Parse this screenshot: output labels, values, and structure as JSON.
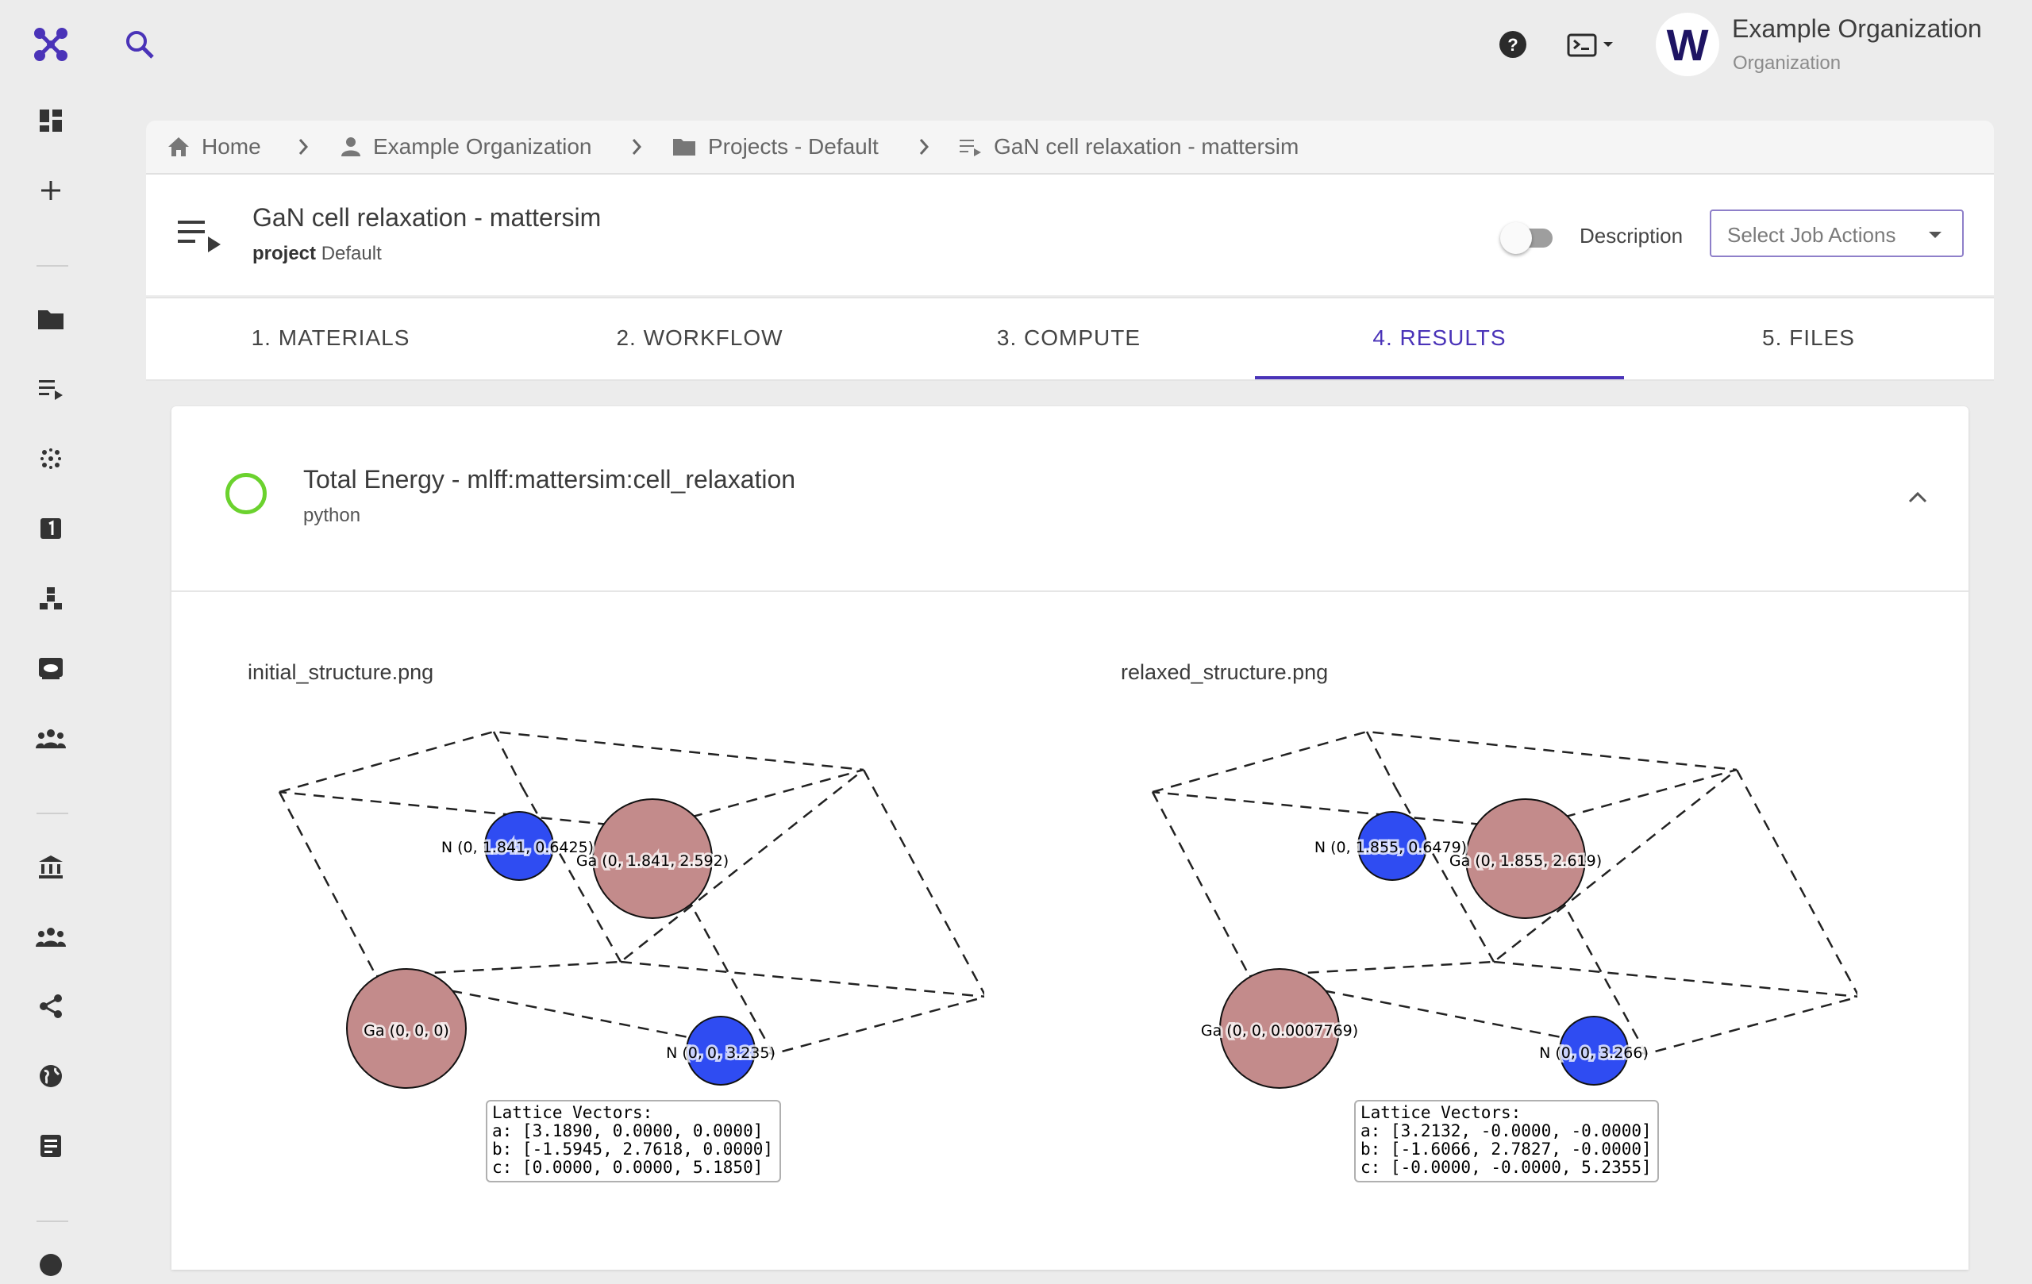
{
  "nav": {
    "items": [
      "Dashboard",
      "Create",
      "Projects",
      "Jobs",
      "Materials",
      "Properties",
      "Workflows",
      "Cloud Jobs",
      "Team",
      "Bank",
      "Accounts",
      "Share",
      "Explore",
      "Logs"
    ]
  },
  "topbar": {
    "org_name": "Example Organization",
    "org_type": "Organization",
    "avatar_letter": "W"
  },
  "breadcrumb": [
    "Home",
    "Example Organization",
    "Projects - Default",
    "GaN cell relaxation - mattersim"
  ],
  "job": {
    "title": "GaN cell relaxation - mattersim",
    "project_label": "project",
    "project_value": "Default",
    "description_label": "Description",
    "description_enabled": false,
    "actions_placeholder": "Select Job Actions"
  },
  "tabs": [
    "1. MATERIALS",
    "2. WORKFLOW",
    "3. COMPUTE",
    "4. RESULTS",
    "5. FILES"
  ],
  "active_tab": "4. RESULTS",
  "result": {
    "title": "Total Energy - mlff:mattersim:cell_relaxation",
    "subtitle": "python",
    "status_color": "#6bd22e"
  },
  "images": [
    {
      "filename": "initial_structure.png",
      "atoms": [
        {
          "label": "N (0, 1.841, 0.6425)",
          "element": "N"
        },
        {
          "label": "Ga (0, 1.841, 2.592)",
          "element": "Ga"
        },
        {
          "label": "Ga (0, 0, 0)",
          "element": "Ga"
        },
        {
          "label": "N (0, 0, 3.235)",
          "element": "N"
        }
      ],
      "lattice": {
        "header": "Lattice Vectors:",
        "a": "a: [3.1890, 0.0000, 0.0000]",
        "b": "b: [-1.5945, 2.7618, 0.0000]",
        "c": "c: [0.0000, 0.0000, 5.1850]"
      }
    },
    {
      "filename": "relaxed_structure.png",
      "atoms": [
        {
          "label": "N (0, 1.855, 0.6479)",
          "element": "N"
        },
        {
          "label": "Ga (0, 1.855, 2.619)",
          "element": "Ga"
        },
        {
          "label": "Ga (0, 0, 0.0007769)",
          "element": "Ga"
        },
        {
          "label": "N (0, 0, 3.266)",
          "element": "N"
        }
      ],
      "lattice": {
        "header": "Lattice Vectors:",
        "a": "a: [3.2132, -0.0000, -0.0000]",
        "b": "b: [-1.6066, 2.7827, -0.0000]",
        "c": "c: [-0.0000, -0.0000, 5.2355]"
      }
    }
  ],
  "colors": {
    "brand": "#4a33b8",
    "ga_atom": "#c38b8b",
    "n_atom": "#2f4cf2"
  }
}
